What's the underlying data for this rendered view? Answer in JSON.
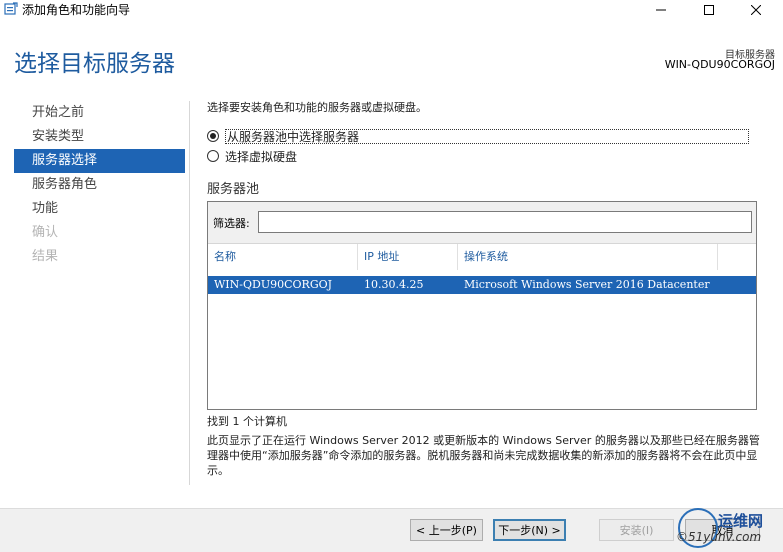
{
  "window": {
    "title": "添加角色和功能向导",
    "minimize_icon": "minimize-icon",
    "maximize_icon": "maximize-icon",
    "close_icon": "close-icon"
  },
  "header": {
    "page_title": "选择目标服务器",
    "destination_label": "目标服务器",
    "destination_server": "WIN-QDU90CORGOJ"
  },
  "nav": {
    "items": [
      {
        "label": "开始之前",
        "state": "normal"
      },
      {
        "label": "安装类型",
        "state": "normal"
      },
      {
        "label": "服务器选择",
        "state": "active"
      },
      {
        "label": "服务器角色",
        "state": "normal"
      },
      {
        "label": "功能",
        "state": "normal"
      },
      {
        "label": "确认",
        "state": "disabled"
      },
      {
        "label": "结果",
        "state": "disabled"
      }
    ]
  },
  "main": {
    "intro": "选择要安装角色和功能的服务器或虚拟硬盘。",
    "option_pool": "从服务器池中选择服务器",
    "option_vhd": "选择虚拟硬盘",
    "pool_heading": "服务器池",
    "filter_label": "筛选器:",
    "filter_value": "",
    "columns": {
      "name": "名称",
      "ip": "IP 地址",
      "os": "操作系统"
    },
    "rows": [
      {
        "name": "WIN-QDU90CORGOJ",
        "ip": "10.30.4.25",
        "os": "Microsoft Windows Server 2016 Datacenter",
        "selected": true
      }
    ],
    "found_text": "找到 1 个计算机",
    "description": "此页显示了正在运行 Windows Server 2012 或更新版本的 Windows Server 的服务器以及那些已经在服务器管理器中使用“添加服务器”命令添加的服务器。脱机服务器和尚未完成数据收集的新添加的服务器将不会在此页中显示。"
  },
  "footer": {
    "prev": "< 上一步(P)",
    "next": "下一步(N) >",
    "install": "安装(I)",
    "cancel": "取消"
  },
  "watermark": {
    "text1": "运维网",
    "text2": "©51yunv.com"
  },
  "colors": {
    "accent": "#1e64b4",
    "title_blue": "#1e5b9f",
    "footer_bg": "#f0f0f0"
  }
}
